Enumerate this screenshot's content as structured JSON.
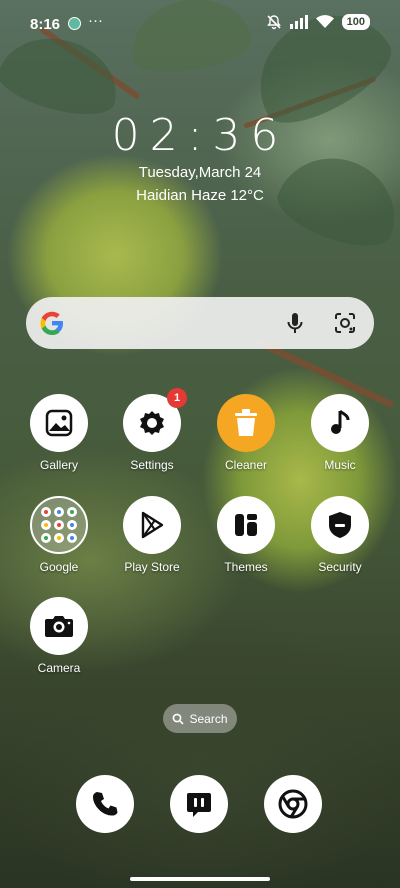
{
  "status_bar": {
    "time": "8:16",
    "more_indicator": "···",
    "battery": "100",
    "icons": [
      "notification-app-icon",
      "mute-icon",
      "signal-icon",
      "wifi-icon",
      "battery-icon"
    ]
  },
  "clock": {
    "time": "02:36",
    "date": "Tuesday,March 24",
    "weather": "Haidian Haze 12°C"
  },
  "search_widget": {
    "icons": [
      "google-logo-icon",
      "microphone-icon",
      "google-lens-icon"
    ]
  },
  "apps": [
    {
      "label": "Gallery",
      "icon": "gallery-icon"
    },
    {
      "label": "Settings",
      "icon": "gear-icon",
      "badge": "1"
    },
    {
      "label": "Cleaner",
      "icon": "trash-icon"
    },
    {
      "label": "Music",
      "icon": "music-note-icon"
    },
    {
      "label": "Google",
      "icon": "google-folder-icon"
    },
    {
      "label": "Play Store",
      "icon": "play-store-icon"
    },
    {
      "label": "Themes",
      "icon": "themes-icon"
    },
    {
      "label": "Security",
      "icon": "shield-icon"
    },
    {
      "label": "Camera",
      "icon": "camera-icon"
    }
  ],
  "app_search": {
    "label": "Search",
    "icon": "search-icon"
  },
  "dock": [
    {
      "name": "Phone",
      "icon": "phone-icon"
    },
    {
      "name": "Messages",
      "icon": "message-icon"
    },
    {
      "name": "Chrome",
      "icon": "chrome-icon"
    }
  ],
  "colors": {
    "cleaner_accent": "#f5a623",
    "badge": "#e53935"
  }
}
